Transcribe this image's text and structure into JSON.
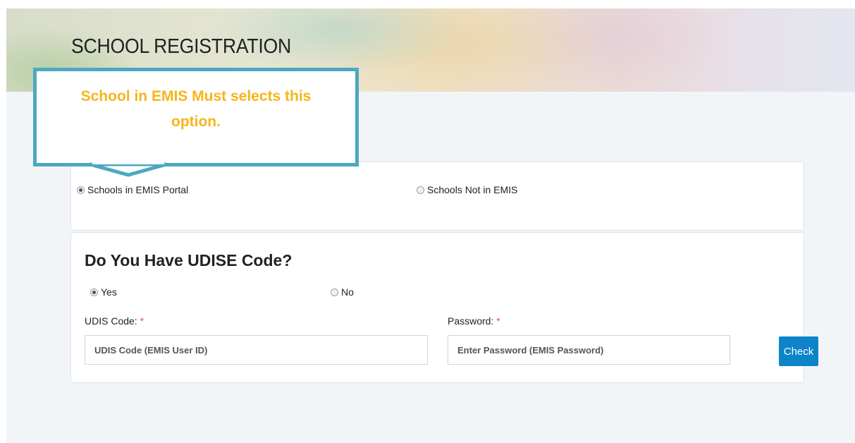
{
  "header": {
    "title": "SCHOOL REGISTRATION"
  },
  "callout": {
    "text": "School in EMIS Must selects this option."
  },
  "school_type": {
    "options": [
      {
        "label": "Schools in EMIS Portal",
        "checked": true
      },
      {
        "label": "Schools Not in EMIS",
        "checked": false
      }
    ]
  },
  "udise": {
    "question": "Do You Have UDISE Code?",
    "options": [
      {
        "label": "Yes",
        "checked": true
      },
      {
        "label": "No",
        "checked": false
      }
    ],
    "udis_code": {
      "label": "UDIS Code:",
      "required_mark": "*",
      "placeholder": "UDIS Code (EMIS User ID)",
      "value": ""
    },
    "password": {
      "label": "Password:",
      "required_mark": "*",
      "placeholder": "Enter Password (EMIS Password)",
      "value": ""
    },
    "check_button": "Check"
  },
  "colors": {
    "callout_border": "#4ba8c2",
    "callout_text": "#f6b519",
    "button": "#0d84c9",
    "required": "#d9534f"
  }
}
